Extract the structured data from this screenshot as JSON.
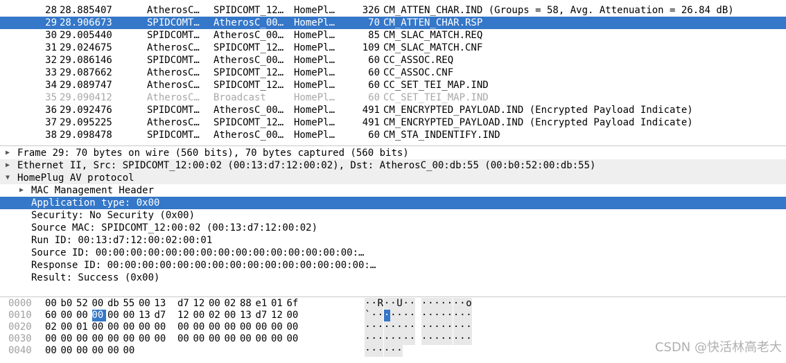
{
  "packets": [
    {
      "no": "28",
      "time": "28.885407",
      "src": "AtherosC…",
      "dst": "SPIDCOMT_12…",
      "proto": "HomePl…",
      "len": "326",
      "info": "CM_ATTEN_CHAR.IND (Groups = 58, Avg. Attenuation = 26.84 dB)",
      "state": "normal"
    },
    {
      "no": "29",
      "time": "28.906673",
      "src": "SPIDCOMT…",
      "dst": "AtherosC_00…",
      "proto": "HomePl…",
      "len": "70",
      "info": "CM_ATTEN_CHAR.RSP",
      "state": "selected"
    },
    {
      "no": "30",
      "time": "29.005440",
      "src": "SPIDCOMT…",
      "dst": "AtherosC_00…",
      "proto": "HomePl…",
      "len": "85",
      "info": "CM_SLAC_MATCH.REQ",
      "state": "normal"
    },
    {
      "no": "31",
      "time": "29.024675",
      "src": "AtherosC…",
      "dst": "SPIDCOMT_12…",
      "proto": "HomePl…",
      "len": "109",
      "info": "CM_SLAC_MATCH.CNF",
      "state": "normal"
    },
    {
      "no": "32",
      "time": "29.086146",
      "src": "SPIDCOMT…",
      "dst": "AtherosC_00…",
      "proto": "HomePl…",
      "len": "60",
      "info": "CC_ASSOC.REQ",
      "state": "normal"
    },
    {
      "no": "33",
      "time": "29.087662",
      "src": "AtherosC…",
      "dst": "SPIDCOMT_12…",
      "proto": "HomePl…",
      "len": "60",
      "info": "CC_ASSOC.CNF",
      "state": "normal"
    },
    {
      "no": "34",
      "time": "29.089747",
      "src": "AtherosC…",
      "dst": "SPIDCOMT_12…",
      "proto": "HomePl…",
      "len": "60",
      "info": "CC_SET_TEI_MAP.IND",
      "state": "normal"
    },
    {
      "no": "35",
      "time": "29.090412",
      "src": "AtherosC…",
      "dst": "Broadcast",
      "proto": "HomePl…",
      "len": "60",
      "info": "CC_SET_TEI_MAP.IND",
      "state": "grey"
    },
    {
      "no": "36",
      "time": "29.092476",
      "src": "SPIDCOMT…",
      "dst": "AtherosC_00…",
      "proto": "HomePl…",
      "len": "491",
      "info": "CM_ENCRYPTED_PAYLOAD.IND (Encrypted Payload Indicate)",
      "state": "normal"
    },
    {
      "no": "37",
      "time": "29.095225",
      "src": "AtherosC…",
      "dst": "SPIDCOMT_12…",
      "proto": "HomePl…",
      "len": "491",
      "info": "CM_ENCRYPTED_PAYLOAD.IND (Encrypted Payload Indicate)",
      "state": "normal"
    },
    {
      "no": "38",
      "time": "29.098478",
      "src": "SPIDCOMT…",
      "dst": "AtherosC_00…",
      "proto": "HomePl…",
      "len": "60",
      "info": "CM_STA_INDENTIFY.IND",
      "state": "normal"
    }
  ],
  "details": [
    {
      "text": "Frame 29: 70 bytes on wire (560 bits), 70 bytes captured (560 bits)",
      "level": 0,
      "toggle": "collapsed",
      "state": "normal"
    },
    {
      "text": "Ethernet II, Src: SPIDCOMT_12:00:02 (00:13:d7:12:00:02), Dst: AtherosC_00:db:55 (00:b0:52:00:db:55)",
      "level": 0,
      "toggle": "collapsed",
      "state": "alt"
    },
    {
      "text": "HomePlug AV protocol",
      "level": 0,
      "toggle": "expanded",
      "state": "alt"
    },
    {
      "text": "MAC Management Header",
      "level": 1,
      "toggle": "collapsed",
      "state": "normal"
    },
    {
      "text": "Application type: 0x00",
      "level": 1,
      "toggle": "none",
      "state": "selected"
    },
    {
      "text": "Security: No Security (0x00)",
      "level": 1,
      "toggle": "none",
      "state": "normal"
    },
    {
      "text": "Source MAC: SPIDCOMT_12:00:02 (00:13:d7:12:00:02)",
      "level": 1,
      "toggle": "none",
      "state": "normal"
    },
    {
      "text": "Run ID: 00:13:d7:12:00:02:00:01",
      "level": 1,
      "toggle": "none",
      "state": "normal"
    },
    {
      "text": "Source ID: 00:00:00:00:00:00:00:00:00:00:00:00:00:00:00:…",
      "level": 1,
      "toggle": "none",
      "state": "normal"
    },
    {
      "text": "Response ID: 00:00:00:00:00:00:00:00:00:00:00:00:00:00:00:…",
      "level": 1,
      "toggle": "none",
      "state": "normal"
    },
    {
      "text": "Result: Success (0x00)",
      "level": 1,
      "toggle": "none",
      "state": "normal"
    }
  ],
  "bytes": [
    {
      "offset": "0000",
      "hex": [
        "00",
        "b0",
        "52",
        "00",
        "db",
        "55",
        "00",
        "13",
        "d7",
        "12",
        "00",
        "02",
        "88",
        "e1",
        "01",
        "6f"
      ],
      "ascii": [
        "·",
        "·",
        "R",
        "·",
        "·",
        "U",
        "·",
        "·",
        "·",
        "·",
        "·",
        "·",
        "·",
        "·",
        "·",
        "o"
      ]
    },
    {
      "offset": "0010",
      "hex": [
        "60",
        "00",
        "00",
        "00",
        "00",
        "00",
        "13",
        "d7",
        "12",
        "00",
        "02",
        "00",
        "13",
        "d7",
        "12",
        "00"
      ],
      "ascii": [
        "`",
        "·",
        "·",
        "·",
        "·",
        "·",
        "·",
        "·",
        "·",
        "·",
        "·",
        "·",
        "·",
        "·",
        "·",
        "·"
      ],
      "highlight": 3
    },
    {
      "offset": "0020",
      "hex": [
        "02",
        "00",
        "01",
        "00",
        "00",
        "00",
        "00",
        "00",
        "00",
        "00",
        "00",
        "00",
        "00",
        "00",
        "00",
        "00"
      ],
      "ascii": [
        "·",
        "·",
        "·",
        "·",
        "·",
        "·",
        "·",
        "·",
        "·",
        "·",
        "·",
        "·",
        "·",
        "·",
        "·",
        "·"
      ]
    },
    {
      "offset": "0030",
      "hex": [
        "00",
        "00",
        "00",
        "00",
        "00",
        "00",
        "00",
        "00",
        "00",
        "00",
        "00",
        "00",
        "00",
        "00",
        "00",
        "00"
      ],
      "ascii": [
        "·",
        "·",
        "·",
        "·",
        "·",
        "·",
        "·",
        "·",
        "·",
        "·",
        "·",
        "·",
        "·",
        "·",
        "·",
        "·"
      ]
    },
    {
      "offset": "0040",
      "hex": [
        "00",
        "00",
        "00",
        "00",
        "00",
        "00"
      ],
      "ascii": [
        "·",
        "·",
        "·",
        "·",
        "·",
        "·"
      ]
    }
  ],
  "watermark": "CSDN @快活林高老大",
  "colors": {
    "selection": "#3577c8",
    "disabled_text": "#a8a8a8"
  }
}
